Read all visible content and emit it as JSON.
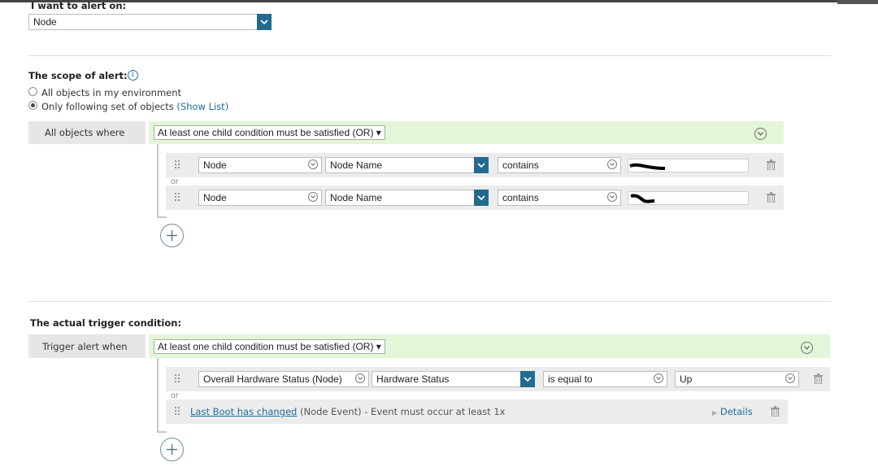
{
  "alert_on": {
    "label": "I want to alert on:",
    "value": "Node"
  },
  "scope": {
    "label": "The scope of alert:",
    "info_icon": "info-icon",
    "options": [
      {
        "label": "All objects in my environment",
        "checked": false
      },
      {
        "label": "Only following set of objects",
        "checked": true
      }
    ],
    "show_list_label": "(Show List)",
    "objects_where_label": "All objects where",
    "group_operator": "At least one child condition must be satisfied (OR)",
    "or_separator": "or",
    "conditions": [
      {
        "entity": "Node",
        "field": "Node Name",
        "operator": "contains",
        "value": ""
      },
      {
        "entity": "Node",
        "field": "Node Name",
        "operator": "contains",
        "value": ""
      }
    ]
  },
  "trigger": {
    "label": "The actual trigger condition:",
    "trigger_when_label": "Trigger alert when",
    "group_operator": "At least one child condition must be satisfied (OR)",
    "or_separator": "or",
    "condition": {
      "entity": "Overall Hardware Status (Node)",
      "field": "Hardware Status",
      "operator": "is equal to",
      "value": "Up"
    },
    "event": {
      "link": "Last Boot has changed",
      "text": "(Node Event) - Event must occur at least 1x",
      "details_label": "Details"
    }
  },
  "colors": {
    "accent": "#236b8e",
    "link": "#1a6fa0",
    "green_bar": "#e3f6d8",
    "panel": "#e6e6e6"
  }
}
